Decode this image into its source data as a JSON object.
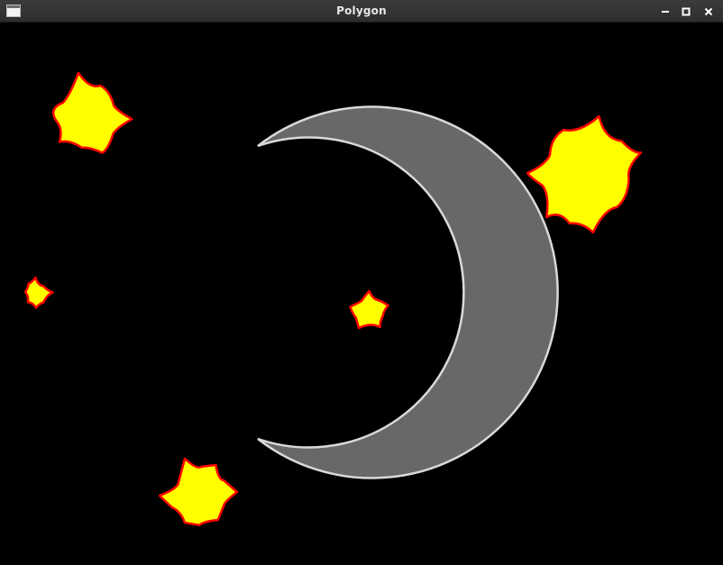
{
  "window": {
    "title": "Polygon"
  },
  "scene": {
    "background_color": "#000000",
    "moon": {
      "fill_color": "#686868",
      "outline_color": "#d9d9d9"
    },
    "star_style": {
      "fill_color": "#ffff00",
      "outline_color": "#ff0000"
    },
    "stars": [
      {
        "id": "star-top-left"
      },
      {
        "id": "star-top-right"
      },
      {
        "id": "star-middle-left-small"
      },
      {
        "id": "star-center-small"
      },
      {
        "id": "star-bottom-left"
      }
    ]
  },
  "icons": {
    "app": "window-app-icon",
    "minimize": "minimize-icon",
    "maximize": "maximize-icon",
    "close": "close-icon"
  }
}
